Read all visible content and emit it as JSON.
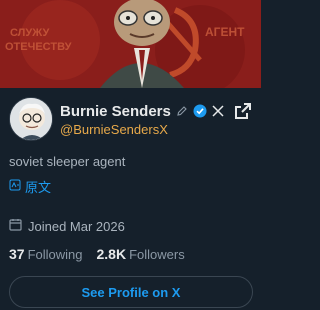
{
  "banner": {
    "left_text": "СЛУЖУ\nОТЕЧЕСТВУ",
    "right_text": "АГЕНТ",
    "bg_color": "#8a1e1b",
    "star_color": "#d65a2a"
  },
  "profile": {
    "name": "Burnie Senders",
    "handle": "@BurnieSendersX",
    "bio": "soviet sleeper agent",
    "translate_label": "原文",
    "joined": "Joined Mar 2026",
    "following_count": "37",
    "following_label": "Following",
    "followers_count": "2.8K",
    "followers_label": "Followers",
    "cta_label": "See Profile on X"
  },
  "icons": {
    "edit": "pencil-icon",
    "verified": "verified-badge-icon",
    "x_logo": "x-logo-icon",
    "open": "external-link-icon",
    "translate": "translate-icon",
    "calendar": "calendar-icon"
  },
  "colors": {
    "background": "#15202b",
    "accent": "#1d9bf0",
    "handle": "#e7a94a",
    "muted": "#8b98a5"
  }
}
